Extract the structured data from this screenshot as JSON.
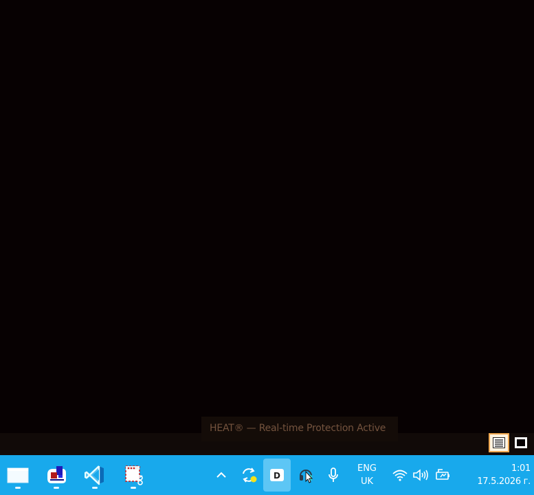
{
  "notification": {
    "text": "HEAT® — Real-time Protection Active"
  },
  "taskbar": {
    "background": "#18a9ec",
    "apps": [
      {
        "name": "file-explorer",
        "running": true
      },
      {
        "name": "paint",
        "running": true
      },
      {
        "name": "visual-studio-code",
        "running": true
      },
      {
        "name": "snipping-tool",
        "running": true
      }
    ],
    "tray": {
      "language_line1": "ENG",
      "language_line2": "UK",
      "time": "1:01",
      "date": "17.5.2026 г."
    }
  },
  "view_buttons": {
    "active_accent": "#f0a850"
  }
}
